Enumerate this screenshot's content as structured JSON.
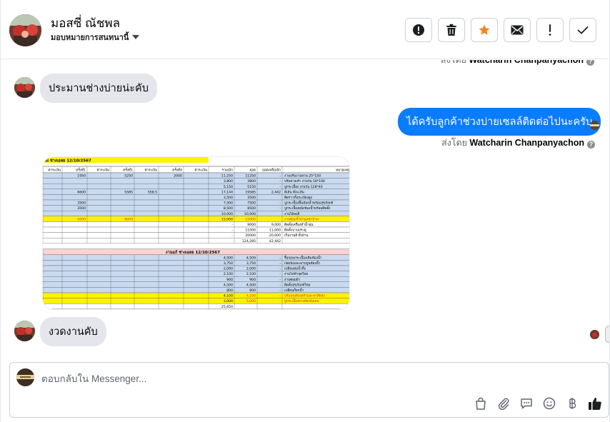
{
  "header": {
    "contact_name": "มอสซี่ ณัชพล",
    "assign_label": "มอบหมายการสนทนานี้",
    "toolbar": [
      {
        "name": "report-spam-button",
        "icon": "exclamation-circle-icon"
      },
      {
        "name": "delete-button",
        "icon": "trash-icon"
      },
      {
        "name": "star-button",
        "icon": "star-icon"
      },
      {
        "name": "mark-unread-button",
        "icon": "envelope-icon"
      },
      {
        "name": "follow-up-button",
        "icon": "exclamation-icon"
      },
      {
        "name": "mark-done-button",
        "icon": "check-icon"
      }
    ]
  },
  "messages": {
    "sent_by_prefix": "ส่งโดย",
    "sent_by_name": "Watcharin Chanpanyachon",
    "msg1": "ประมานช่างบ่ายน่ะคับ",
    "msg2": "ได้ครับลูกค้าช่วงบ่ายเซลล์ติดต่อไปนะครับ",
    "msg3": "งวดงานคับ"
  },
  "sheet": {
    "header_title": "ณ่ ช่างเอลย 12/10/2567",
    "columns": [
      "ค่าระเงิน",
      "ครั้งที่1",
      "ค่าระเงิน",
      "ครั้งที่1",
      "ค่าระเงิน",
      "ครั้งที่4",
      "ค่าระเงิน",
      "รวมเบิก",
      "ยอด",
      "ยอดเหลือเบิก",
      "หมายเหตุ"
    ],
    "section2_title": "งานแก้ ช่างเอลย 12/10/2567",
    "rows_top": [
      [
        "",
        "1950",
        "",
        "5250",
        "",
        "2000",
        "",
        "11,250",
        "11250",
        "-",
        "งานปรับงานลาน 25*150"
      ],
      [
        "",
        "",
        "",
        "",
        "",
        "",
        "",
        "3,800",
        "3800",
        "-",
        "ปรับทางเท้า งานวัน 18*100"
      ],
      [
        "",
        "",
        "",
        "",
        "",
        "",
        "",
        "5,150",
        "5150",
        "-",
        "ปูกระเบื้อง งานวัน 128*40"
      ],
      [
        "",
        "6600",
        "",
        "5585",
        "558.5",
        "",
        "",
        "17,144",
        "19585",
        "2,442",
        "ตีเส้น ทีละเส้น"
      ],
      [
        "",
        "",
        "",
        "",
        "",
        "",
        "",
        "3,500",
        "3500",
        "",
        "ติดราวกั้นระเบียงสูง"
      ],
      [
        "",
        "3500",
        "",
        "",
        "",
        "",
        "",
        "7,500",
        "7500",
        "-",
        "ปูกระเบื้องพื้นห้องน้ำพร้อมสุขภัณฑ์"
      ],
      [
        "",
        "3500",
        "",
        "",
        "",
        "",
        "",
        "8,500",
        "8500",
        "-",
        "ปูกระเบื้องผนังห้องน้ำพร้อมติดตั้ง"
      ],
      [
        "",
        "",
        "",
        "",
        "",
        "",
        "",
        "10,000",
        "10,000",
        "",
        "งานไม้ลงสี"
      ],
      [
        "",
        "5000",
        "",
        "8000",
        "",
        "",
        "",
        "15,000",
        "15000",
        "",
        "งานซ่อมรั้วบ้านหน้าบ้าน"
      ],
      [
        "",
        "",
        "",
        "",
        "",
        "",
        "",
        "-",
        "9000",
        "9,000",
        "ติดตั้งเครื่องทำน้ำอุ่น"
      ],
      [
        "",
        "",
        "",
        "",
        "",
        "",
        "",
        "-",
        "11000",
        "11,000",
        "ติดตั้งบานประตู"
      ],
      [
        "",
        "",
        "",
        "",
        "",
        "",
        "",
        "-",
        "20000",
        "20,000",
        "เก็บงานสี ทั้งบ้าน"
      ],
      [
        "",
        "",
        "",
        "",
        "",
        "",
        "",
        "",
        "124,285",
        "42,442",
        ""
      ]
    ],
    "rows_bottom": [
      [
        "4,500",
        "4,500",
        "-",
        "รื้อถอนกระเบื้องเดิมห้องน้ำ"
      ],
      [
        "3,750",
        "3,750",
        "-",
        "ก่อผนังและฉาบปูนห้องน้ำ"
      ],
      [
        "2,000",
        "2,000",
        "-",
        "เปลี่ยนท่อน้ำทิ้ง"
      ],
      [
        "2,100",
        "2,100",
        "-",
        "งานไฟฟ้าจุดใหม่"
      ],
      [
        "900",
        "900",
        "-",
        "งานซ่อมฝ้า"
      ],
      [
        "4,500",
        "4,500",
        "-",
        "ติดตั้งสุขภัณฑ์ใหม่"
      ],
      [
        "800",
        "800",
        "-",
        "เปลี่ยนก๊อกน้ำ"
      ],
      [
        "4,100",
        "4,100",
        "-",
        "ปรับปรุงห้องครัวและทาสีผนัง"
      ],
      [
        "3,000",
        "3,000",
        "-",
        "ปูกระเบื้องยางห้องนั่งเล่น"
      ],
      [
        "25,650",
        "",
        "",
        ""
      ]
    ]
  },
  "composer": {
    "placeholder": "ตอบกลับใน Messenger...",
    "tools": [
      "bag-icon",
      "paperclip-icon",
      "speech-bubble-icon",
      "smiley-icon",
      "baht-icon",
      "thumbs-up-icon"
    ]
  },
  "colors": {
    "accent": "#0a7cff",
    "sheet_yellow": "#fff200",
    "sheet_blue": "#c9daf0",
    "sheet_pink": "#f8d3d0",
    "star": "#f5821f"
  }
}
